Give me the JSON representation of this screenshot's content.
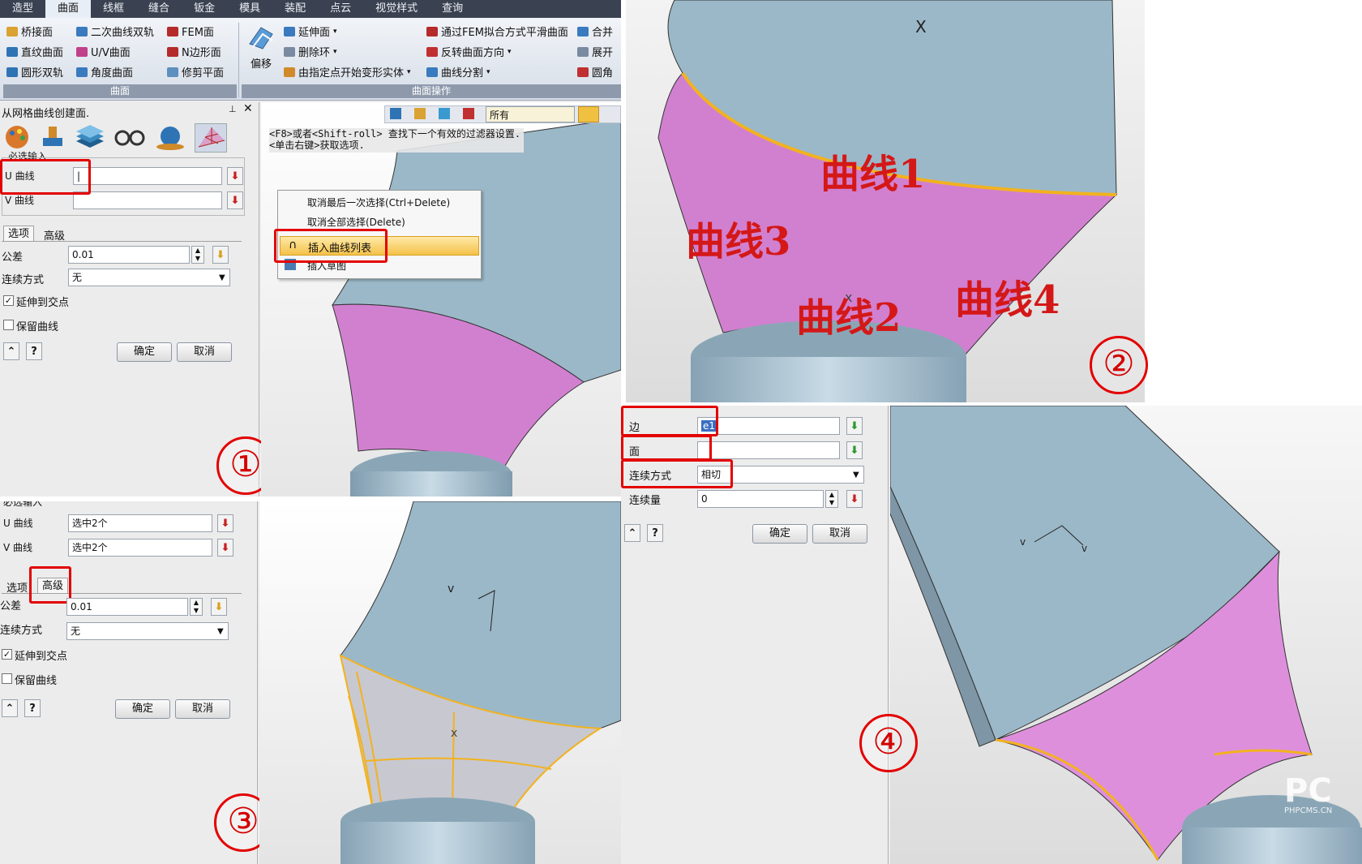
{
  "ribbon": {
    "tabs": [
      "造型",
      "曲面",
      "线框",
      "缝合",
      "钣金",
      "模具",
      "装配",
      "点云",
      "视觉样式",
      "查询"
    ],
    "active_tab": "曲面",
    "group1": {
      "label": "曲面",
      "items": [
        [
          "桥接面",
          "二次曲线双轨",
          "FEM面"
        ],
        [
          "直纹曲面",
          "U/V曲面",
          "N边形面"
        ],
        [
          "圆形双轨",
          "角度曲面",
          "修剪平面"
        ]
      ]
    },
    "offset_label": "偏移",
    "group2": {
      "label": "曲面操作",
      "col1": [
        "延伸面",
        "删除环",
        "由指定点开始变形实体"
      ],
      "col2": [
        "通过FEM拟合方式平滑曲面",
        "反转曲面方向",
        "曲线分割"
      ],
      "col3": [
        "合并",
        "展开",
        "圆角"
      ]
    }
  },
  "panel1": {
    "title": "从网格曲线创建面.",
    "section": "必选输入",
    "u_label": "U 曲线",
    "u_value": "|",
    "v_label": "V 曲线",
    "v_value": "",
    "tab_options": "选项",
    "tab_advanced": "高级",
    "tol_label": "公差",
    "tol_value": "0.01",
    "cont_label": "连续方式",
    "cont_value": "无",
    "extend_label": "延伸到交点",
    "keep_label": "保留曲线",
    "ok": "确定",
    "cancel": "取消",
    "filter_value": "所有",
    "hint_line1": "<F8>或者<Shift-roll> 查找下一个有效的过滤器设置.",
    "hint_line2": "<单击右键>获取选项.",
    "context_menu": [
      "取消最后一次选择(Ctrl+Delete)",
      "取消全部选择(Delete)",
      "插入曲线列表",
      "插入草图"
    ],
    "marker": "①"
  },
  "panel2": {
    "labels": [
      "曲线1",
      "曲线3",
      "曲线2",
      "曲线4"
    ],
    "marker": "②"
  },
  "panel3": {
    "section": "必选输入",
    "u_label": "U 曲线",
    "u_value": "选中2个",
    "v_label": "V 曲线",
    "v_value": "选中2个",
    "tab_options": "选项",
    "tab_advanced": "高级",
    "tol_label": "公差",
    "tol_value": "0.01",
    "cont_label": "连续方式",
    "cont_value": "无",
    "extend_label": "延伸到交点",
    "keep_label": "保留曲线",
    "ok": "确定",
    "cancel": "取消",
    "marker": "③"
  },
  "panel4": {
    "edge_label": "边",
    "edge_value": "e1",
    "face_label": "面",
    "face_value": "",
    "cont_label": "连续方式",
    "cont_value": "相切",
    "amount_label": "连续量",
    "amount_value": "0",
    "ok": "确定",
    "cancel": "取消",
    "marker": "④",
    "watermark": "PC",
    "watermark_sub": "PHPCMS.CN"
  },
  "colors": {
    "surface_blue": "#9bb8c8",
    "patch_magenta": "#d180d0",
    "highlight": "#f2b21f",
    "annotation_red": "#e30000"
  }
}
